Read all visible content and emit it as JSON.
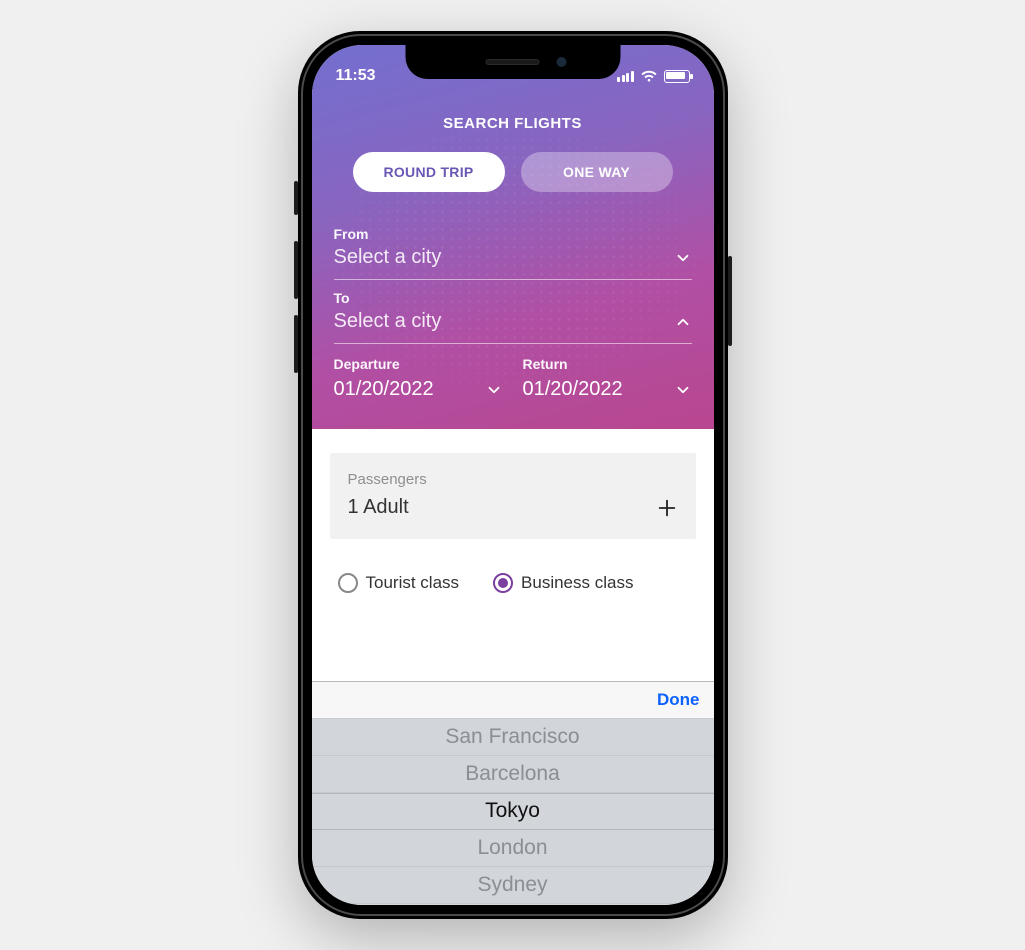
{
  "status": {
    "time": "11:53"
  },
  "header": {
    "title": "SEARCH FLIGHTS"
  },
  "tabs": {
    "round_trip": "ROUND TRIP",
    "one_way": "ONE WAY"
  },
  "from": {
    "label": "From",
    "value": "Select a city"
  },
  "to": {
    "label": "To",
    "value": "Select a city"
  },
  "departure": {
    "label": "Departure",
    "value": "01/20/2022"
  },
  "return": {
    "label": "Return",
    "value": "01/20/2022"
  },
  "passengers": {
    "label": "Passengers",
    "value": "1 Adult"
  },
  "class": {
    "tourist": "Tourist class",
    "business": "Business class"
  },
  "picker": {
    "done": "Done",
    "options": [
      "San Francisco",
      "Barcelona",
      "Tokyo",
      "London",
      "Sydney"
    ],
    "selected_index": 2
  }
}
